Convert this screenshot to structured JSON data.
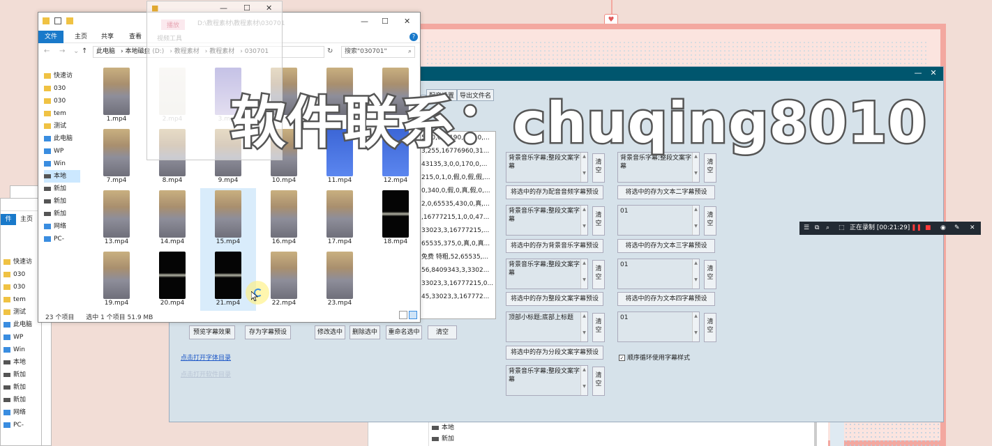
{
  "background": {
    "accent": "#f3a8a0"
  },
  "back_explorer": {
    "tab_file": "件",
    "tab_home": "主页",
    "nav_items": [
      {
        "icon": "folder",
        "label": "快速访"
      },
      {
        "icon": "folder",
        "label": "030"
      },
      {
        "icon": "folder",
        "label": "030"
      },
      {
        "icon": "folder",
        "label": "tem"
      },
      {
        "icon": "folder",
        "label": "测试"
      },
      {
        "icon": "pc",
        "label": "此电脑"
      },
      {
        "icon": "pc",
        "label": "WP"
      },
      {
        "icon": "pc",
        "label": "Win"
      },
      {
        "icon": "drive",
        "label": "本地"
      },
      {
        "icon": "drive",
        "label": "新加"
      },
      {
        "icon": "drive",
        "label": "新加"
      },
      {
        "icon": "drive",
        "label": "新加"
      },
      {
        "icon": "pc",
        "label": "网络"
      },
      {
        "icon": "pc",
        "label": "PC-"
      }
    ]
  },
  "explorer": {
    "ribbon": {
      "file": "文件",
      "home": "主页",
      "share": "共享",
      "view": "查看"
    },
    "path": [
      "此电脑",
      "本地磁盘 (D:)",
      "教程素材",
      "教程素材",
      "030701"
    ],
    "search_placeholder": "搜索\"030701\"",
    "nav_items": [
      {
        "label": "快速访",
        "sel": false
      },
      {
        "label": "030",
        "sel": false
      },
      {
        "label": "030",
        "sel": false
      },
      {
        "label": "tem",
        "sel": false
      },
      {
        "label": "测试",
        "sel": false
      },
      {
        "label": "此电脑",
        "sel": false
      },
      {
        "label": "WP",
        "sel": false
      },
      {
        "label": "Win",
        "sel": false
      },
      {
        "label": "本地",
        "sel": true
      },
      {
        "label": "新加",
        "sel": false
      },
      {
        "label": "新加",
        "sel": false
      },
      {
        "label": "新加",
        "sel": false
      },
      {
        "label": "网络",
        "sel": false
      },
      {
        "label": "PC-",
        "sel": false
      }
    ],
    "files": [
      {
        "name": "1.mp4",
        "kind": "photo"
      },
      {
        "name": "2.mp4",
        "kind": "faded"
      },
      {
        "name": "3.mp4",
        "kind": "purple"
      },
      {
        "name": "",
        "kind": "photo"
      },
      {
        "name": "",
        "kind": "photo"
      },
      {
        "name": "",
        "kind": "photo"
      },
      {
        "name": "7.mp4",
        "kind": "photo"
      },
      {
        "name": "8.mp4",
        "kind": "photo"
      },
      {
        "name": "9.mp4",
        "kind": "photo"
      },
      {
        "name": "10.mp4",
        "kind": "photo"
      },
      {
        "name": "11.mp4",
        "kind": "blue"
      },
      {
        "name": "12.mp4",
        "kind": "blue"
      },
      {
        "name": "13.mp4",
        "kind": "photo"
      },
      {
        "name": "14.mp4",
        "kind": "photo"
      },
      {
        "name": "15.mp4",
        "kind": "photo"
      },
      {
        "name": "16.mp4",
        "kind": "photo"
      },
      {
        "name": "17.mp4",
        "kind": "photo"
      },
      {
        "name": "18.mp4",
        "kind": "black"
      },
      {
        "name": "19.mp4",
        "kind": "photo"
      },
      {
        "name": "20.mp4",
        "kind": "black"
      },
      {
        "name": "21.mp4",
        "kind": "black"
      },
      {
        "name": "22.mp4",
        "kind": "photo"
      },
      {
        "name": "23.mp4",
        "kind": "photo"
      }
    ],
    "status_count": "23 个项目",
    "status_selected": "选中 1 个项目  51.9 MB"
  },
  "ghost_window": {
    "label_play": "播放",
    "label_tools": "视频工具",
    "path": "D:\\教程素材\\教程素材\\030701"
  },
  "app": {
    "menu": [
      "",
      "配音设置",
      "导出文件名"
    ],
    "list_rows": [
      "56,0,0,0,190,9,假,0,...",
      "3,255,16776960,31...",
      "43135,3,0,0,170,0,...",
      "215,0,1,0,假,0,假,假,...",
      "0,340,0,假,0,真,假,0,...",
      "2,0,65535,430,0,真,...",
      ",16777215,1,0,0,47...",
      "33023,3,16777215,...",
      "65535,375,0,真,0,真...",
      "免费 特粗,52,65535,...",
      "56,8409343,3,3302...",
      "33023,3,16777215,0...",
      "45,33023,3,167772..."
    ],
    "left_boxes": [
      "背景音乐字幕;整段文案字幕",
      "背景音乐字幕;整段文案字幕",
      "背景音乐字幕;整段文案字幕",
      "顶部小标题;底部上标题",
      "背景音乐字幕;整段文案字幕"
    ],
    "right_boxes": [
      "背景音乐字幕;整段文案字幕",
      "01",
      "01",
      "01"
    ],
    "clear_label": "清空",
    "save_buttons_left": [
      "将选中的存为配音音频字幕预设",
      "将选中的存为背景音乐字幕预设",
      "将选中的存为整段文案字幕预设",
      "将选中的存为分段文案字幕预设"
    ],
    "save_buttons_right": [
      "将选中的存为文本二字幕预设",
      "将选中的存为文本三字幕预设",
      "将选中的存为文本四字幕预设"
    ],
    "bottom_buttons": {
      "preview": "预览字幕效果",
      "save_preset": "存为字幕预设",
      "modify": "修改选中",
      "delete": "删除选中",
      "rename": "重命名选中",
      "clear": "清空"
    },
    "link_font_dir": "点击打开字体目录",
    "link_soft_dir": "点击打开软件目录",
    "checkbox_cycle": {
      "label": "顺序循环使用字幕样式",
      "checked": true
    }
  },
  "watermark": "软件联系：chuqing8010",
  "recording": {
    "label": "正在录制 [00:21:29]"
  },
  "bottom_nav": [
    "本地",
    "新加"
  ]
}
